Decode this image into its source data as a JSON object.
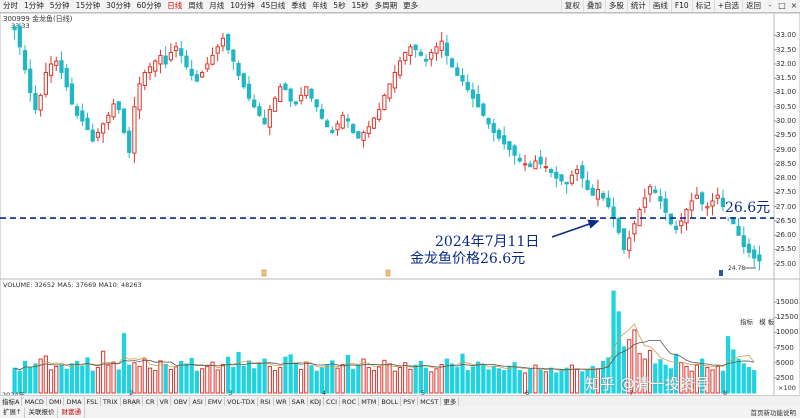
{
  "toolbar": {
    "items": [
      "分时",
      "1分钟",
      "5分钟",
      "15分钟",
      "30分钟",
      "60分钟",
      "日线",
      "周线",
      "月线",
      "10分钟",
      "45日线",
      "季线",
      "年线",
      "5秒",
      "15秒",
      "多周期",
      "更多"
    ],
    "active_index": 6,
    "right_items": [
      "复权",
      "叠加",
      "多股",
      "统计",
      "画线",
      "F10",
      "标记",
      "+自选",
      "返回"
    ],
    "window_buttons": [
      "-",
      "□",
      "×"
    ]
  },
  "stock": {
    "label": "300999 金龙鱼(日线)",
    "high_label": "33.33",
    "low_label": "24.78"
  },
  "chart_data": {
    "type": "candlestick",
    "y_ticks": [
      "33.00",
      "32.50",
      "32.00",
      "31.50",
      "31.00",
      "30.50",
      "30.00",
      "29.50",
      "29.00",
      "28.50",
      "28.00",
      "27.50",
      "27.00",
      "26.50",
      "26.00",
      "25.50",
      "25.00"
    ],
    "ylim": [
      24.78,
      33.33
    ],
    "x_labels": [
      "2024年",
      "2",
      "3",
      "4",
      "5",
      "6",
      "7",
      "8"
    ],
    "reference_line": {
      "value": 26.6,
      "label": "26.6元"
    },
    "annotation": {
      "line1": "2024年7月11日",
      "line2": "金龙鱼价格26.6元"
    },
    "closes": [
      33.2,
      32.6,
      31.8,
      31.0,
      30.4,
      30.9,
      31.7,
      32.0,
      32.1,
      31.7,
      31.2,
      30.6,
      30.2,
      30.0,
      29.7,
      29.3,
      29.6,
      29.9,
      30.2,
      30.6,
      30.4,
      29.6,
      28.9,
      30.5,
      31.3,
      31.7,
      31.9,
      32.1,
      32.3,
      32.0,
      32.4,
      32.6,
      32.3,
      31.9,
      31.6,
      31.4,
      31.7,
      32.0,
      32.3,
      32.6,
      32.9,
      32.5,
      32.1,
      31.6,
      31.2,
      30.8,
      30.5,
      30.2,
      29.9,
      30.4,
      30.8,
      31.2,
      31.1,
      30.7,
      30.6,
      30.9,
      31.2,
      30.8,
      30.5,
      30.1,
      29.8,
      29.6,
      29.9,
      30.2,
      30.0,
      29.6,
      29.4,
      29.6,
      29.8,
      30.1,
      30.4,
      30.9,
      31.3,
      31.7,
      32.1,
      32.4,
      32.6,
      32.5,
      32.3,
      32.1,
      32.4,
      32.6,
      32.8,
      32.3,
      31.9,
      31.6,
      31.4,
      31.1,
      30.8,
      30.5,
      30.2,
      29.9,
      29.6,
      29.4,
      29.2,
      29.0,
      28.8,
      28.6,
      28.5,
      28.4,
      28.6,
      28.5,
      28.4,
      28.2,
      28.0,
      27.9,
      27.8,
      28.1,
      28.3,
      28.0,
      27.6,
      27.4,
      27.6,
      27.3,
      27.0,
      26.6,
      26.1,
      25.5,
      25.9,
      26.4,
      26.9,
      27.3,
      27.7,
      27.5,
      27.2,
      26.8,
      26.4,
      26.2,
      26.5,
      26.9,
      27.2,
      27.4,
      27.1,
      27.0,
      27.2,
      27.4,
      27.0,
      26.8,
      26.4,
      26.0,
      25.6,
      25.4,
      25.2,
      25.1
    ],
    "volume": {
      "label": "VOLUME: 32652  MA5: 37669  MA10: 48263",
      "y_ticks": [
        "15000",
        "12500",
        "10000",
        "7500",
        "5000",
        "2500"
      ],
      "ylim": [
        0,
        17000
      ],
      "values": [
        4100,
        3600,
        5200,
        4200,
        4800,
        5600,
        6100,
        3800,
        4400,
        4600,
        3900,
        4800,
        5200,
        4400,
        5800,
        3600,
        4200,
        6900,
        4600,
        5100,
        3800,
        9800,
        4600,
        5000,
        4400,
        5600,
        4100,
        3700,
        5300,
        4700,
        3900,
        4300,
        5200,
        4800,
        5700,
        3600,
        4000,
        4400,
        5100,
        3800,
        4700,
        5900,
        4200,
        6700,
        4400,
        5300,
        4000,
        4800,
        5600,
        4400,
        3700,
        4200,
        5900,
        6300,
        4800,
        3900,
        5100,
        4500,
        3600,
        4100,
        4600,
        5300,
        4100,
        4700,
        6200,
        3900,
        4600,
        5600,
        4200,
        3700,
        4300,
        5400,
        4800,
        3600,
        4200,
        5000,
        3900,
        4600,
        5200,
        4100,
        3500,
        4000,
        4700,
        5600,
        4800,
        4200,
        6400,
        3700,
        4300,
        5100,
        4600,
        3800,
        4400,
        4000,
        3700,
        4300,
        5000,
        3700,
        3300,
        4000,
        4600,
        3800,
        3500,
        4100,
        3300,
        3800,
        4100,
        4600,
        3900,
        3500,
        3800,
        4400,
        4000,
        5200,
        5800,
        16800,
        13400,
        7600,
        8800,
        10400,
        6500,
        5600,
        7000,
        4800,
        5500,
        4600,
        4000,
        6400,
        5000,
        4400,
        3600,
        4600,
        5600,
        4200,
        3800,
        4400,
        3600,
        9300,
        7100,
        5600,
        4800,
        4200,
        3700
      ]
    }
  },
  "month_labels": [
    "2024年",
    "2",
    "3",
    "4",
    "5",
    "6",
    "7",
    "8"
  ],
  "volume_extra_right": [
    "指标   模 板",
    "×100"
  ],
  "indicator_tabs": [
    "指标A",
    "MACD",
    "DMI",
    "DMA",
    "FSL",
    "TRIX",
    "BRAR",
    "CR",
    "VR",
    "OBV",
    "ASI",
    "EMV",
    "VOL-TDX",
    "RSI",
    "WR",
    "SAR",
    "KDJ",
    "CCI",
    "ROC",
    "MTM",
    "BOLL",
    "PSY",
    "MCST",
    "更多"
  ],
  "bottom_bar": [
    "扩展↑",
    "关联报价",
    "财富通"
  ],
  "bottom_right": "首页新功能说明",
  "watermark": "知乎 @清一投资号"
}
